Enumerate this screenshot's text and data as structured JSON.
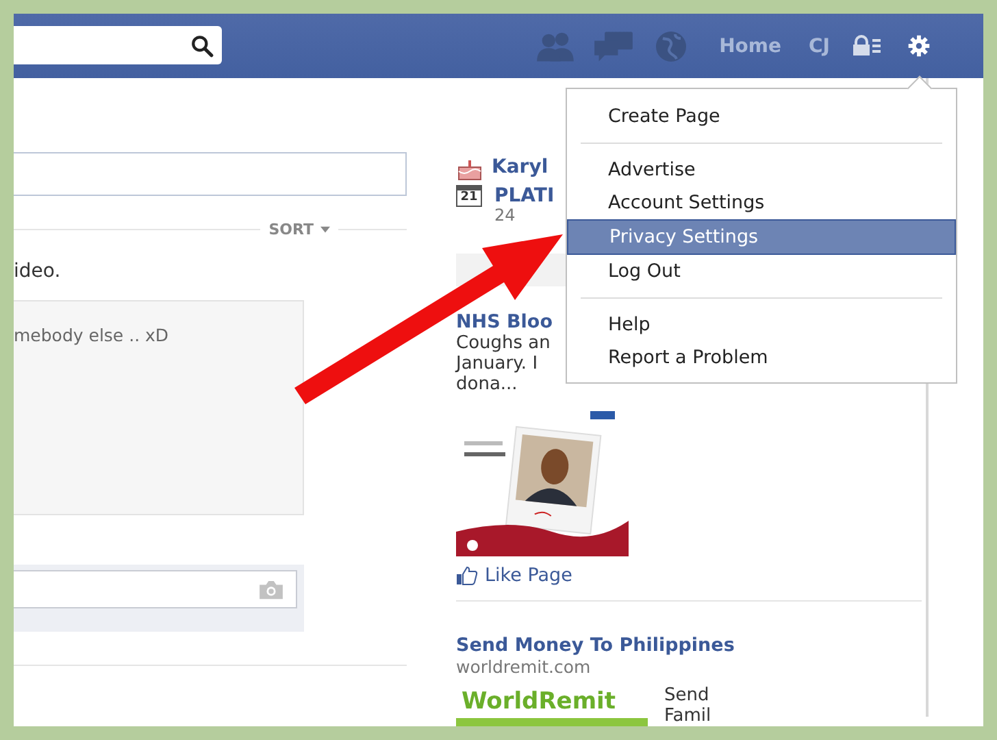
{
  "top_bar": {
    "nav": [
      "Home",
      "CJ"
    ]
  },
  "feed": {
    "sort": "SORT",
    "post_text": "ideo.",
    "comment_preview": "mebody else .. xD"
  },
  "sidebar": {
    "events": [
      {
        "kind": "birthday",
        "title": "Karyl"
      },
      {
        "kind": "date",
        "date_icon": "21",
        "title": "PLATI",
        "subtitle": "24"
      }
    ],
    "ads": [
      {
        "kind": "image_ad",
        "title": "NHS Bloo",
        "body": [
          "Coughs an",
          "January. I",
          "dona..."
        ],
        "image": {
          "kind": "picture"
        },
        "like": "Like Page"
      },
      {
        "kind": "logo_ad",
        "title": "Send Money To Philippines",
        "domain": "worldremit.com",
        "logo": "WorldRemit",
        "body": [
          "Send",
          "Famil"
        ]
      }
    ]
  },
  "menu": {
    "groups": [
      [
        {
          "label": "Create Page",
          "selected": false
        }
      ],
      [
        {
          "label": "Advertise",
          "selected": false
        },
        {
          "label": "Account Settings",
          "selected": false
        },
        {
          "label": "Privacy Settings",
          "selected": true
        },
        {
          "label": "Log Out",
          "selected": false
        }
      ],
      [
        {
          "label": "Help",
          "selected": false
        },
        {
          "label": "Report a Problem",
          "selected": false
        }
      ]
    ]
  }
}
